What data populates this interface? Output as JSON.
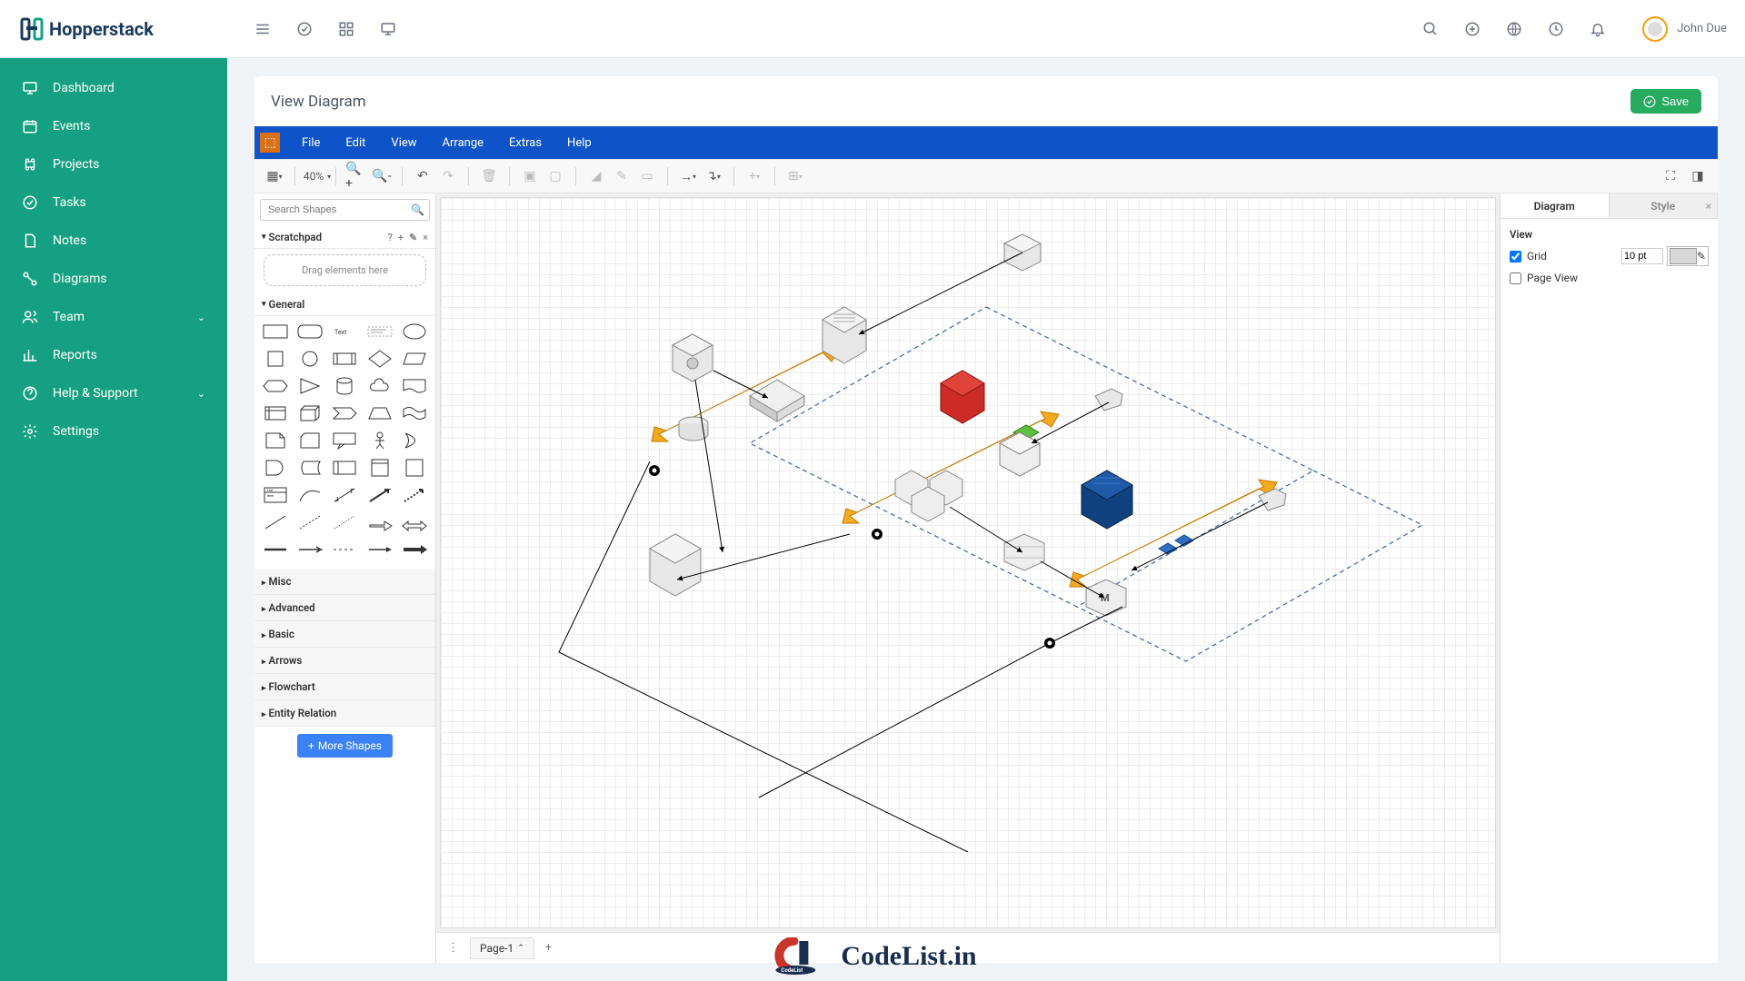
{
  "brand": "Hopperstack",
  "user": {
    "name": "John Due"
  },
  "sidebar": {
    "items": [
      {
        "label": "Dashboard"
      },
      {
        "label": "Events"
      },
      {
        "label": "Projects"
      },
      {
        "label": "Tasks"
      },
      {
        "label": "Notes"
      },
      {
        "label": "Diagrams"
      },
      {
        "label": "Team"
      },
      {
        "label": "Reports"
      },
      {
        "label": "Help & Support"
      },
      {
        "label": "Settings"
      }
    ]
  },
  "page": {
    "title": "View Diagram",
    "save_label": "Save"
  },
  "menubar": [
    "File",
    "Edit",
    "View",
    "Arrange",
    "Extras",
    "Help"
  ],
  "toolbar": {
    "zoom": "40%"
  },
  "shapes_panel": {
    "search_placeholder": "Search Shapes",
    "scratchpad_label": "Scratchpad",
    "scratchpad_drop": "Drag elements here",
    "general_label": "General",
    "collapsed": [
      "Misc",
      "Advanced",
      "Basic",
      "Arrows",
      "Flowchart",
      "Entity Relation"
    ],
    "more_shapes": "More Shapes"
  },
  "right_panel": {
    "tab_diagram": "Diagram",
    "tab_style": "Style",
    "view_label": "View",
    "grid_label": "Grid",
    "grid_value": "10 pt",
    "pageview_label": "Page View"
  },
  "pages": {
    "page1": "Page-1"
  },
  "footer": {
    "text": "CodeList.in"
  }
}
